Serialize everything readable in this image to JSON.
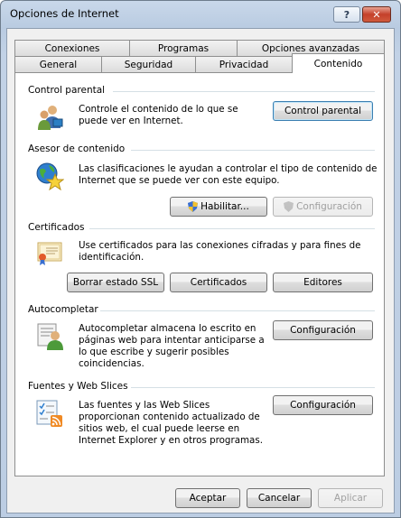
{
  "window": {
    "title": "Opciones de Internet",
    "help_label": "?",
    "close_label": "✕"
  },
  "tabs_back": [
    {
      "label": "Conexiones"
    },
    {
      "label": "Programas"
    },
    {
      "label": "Opciones avanzadas"
    }
  ],
  "tabs_front": [
    {
      "label": "General"
    },
    {
      "label": "Seguridad"
    },
    {
      "label": "Privacidad"
    },
    {
      "label": "Contenido"
    }
  ],
  "parental": {
    "header": "Control parental",
    "text_1": "Controle el contenido de lo que se",
    "text_2": "puede ver en Internet.",
    "button": "Control parental"
  },
  "advisor": {
    "header": "Asesor de contenido",
    "text_1": "Las clasificaciones le ayudan a controlar el tipo de contenido de",
    "text_2": "Internet que se puede ver con este equipo.",
    "enable_button": "Habilitar...",
    "config_button": "Configuración"
  },
  "certificates": {
    "header": "Certificados",
    "text_1": "Use certificados para las conexiones cifradas y para fines de",
    "text_2": "identificación.",
    "clear_ssl_button": "Borrar estado SSL",
    "certs_button": "Certificados",
    "publishers_button": "Editores"
  },
  "autocomplete": {
    "header": "Autocompletar",
    "text_1": "Autocompletar almacena lo escrito en",
    "text_2": "páginas web para intentar anticiparse a",
    "text_3": "lo que escribe y sugerir posibles",
    "text_4": "coincidencias.",
    "button": "Configuración"
  },
  "feeds": {
    "header": "Fuentes y Web Slices",
    "text_1": "Las fuentes y las Web Slices",
    "text_2": "proporcionan contenido actualizado de",
    "text_3": "sitios web, el cual puede leerse en",
    "text_4": "Internet Explorer y en otros programas.",
    "button": "Configuración"
  },
  "footer": {
    "ok": "Aceptar",
    "cancel": "Cancelar",
    "apply": "Aplicar"
  },
  "icons": [
    "family-users-icon",
    "globe-star-icon",
    "certificate-icon",
    "autocomplete-user-icon",
    "feeds-checklist-icon",
    "uac-shield-icon"
  ]
}
